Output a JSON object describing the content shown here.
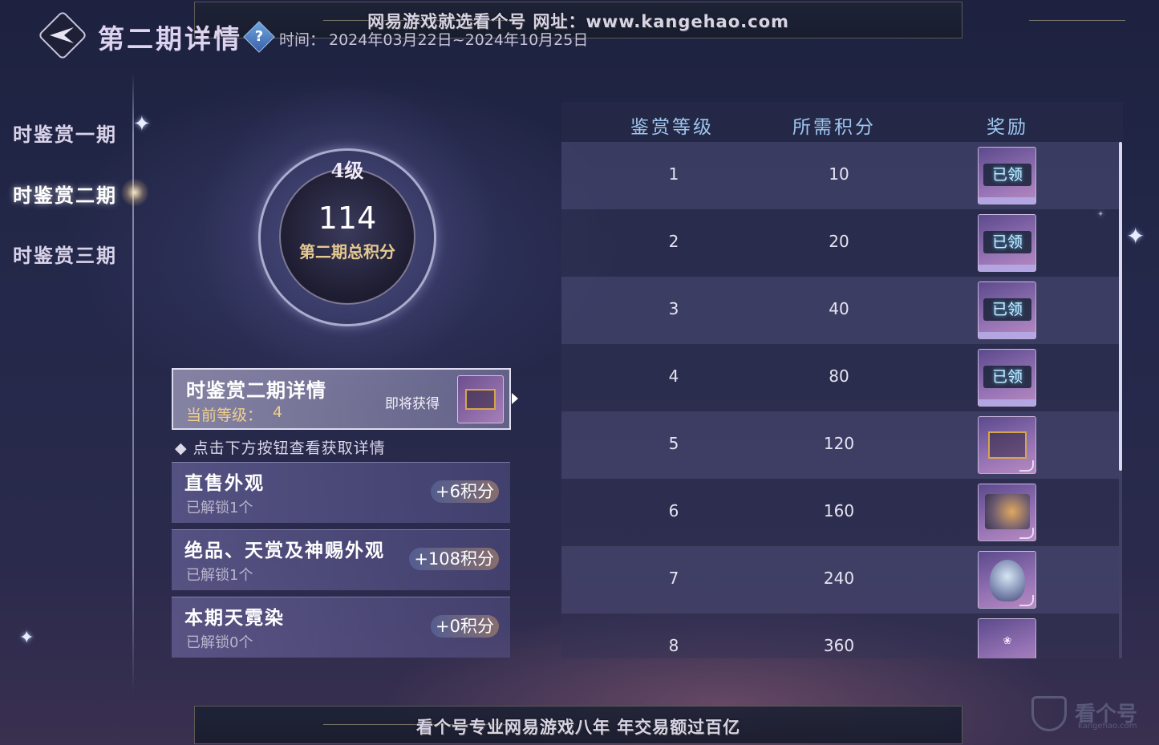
{
  "watermark_top": "网易游戏就选看个号  网址：www.kangehao.com",
  "watermark_bottom": "看个号专业网易游戏八年  年交易额过百亿",
  "header": {
    "title": "第二期详情",
    "help_symbol": "?",
    "time_label": "时间：",
    "time_value": "2024年03月22日~2024年10月25日"
  },
  "nav": {
    "items": [
      {
        "label": "时鉴赏一期",
        "active": false
      },
      {
        "label": "时鉴赏二期",
        "active": true
      },
      {
        "label": "时鉴赏三期",
        "active": false
      }
    ]
  },
  "medal": {
    "level": "4级",
    "score": "114",
    "caption": "第二期总积分"
  },
  "detail_card": {
    "title": "时鉴赏二期详情",
    "current_level_label": "当前等级：",
    "current_level_value": "4",
    "soon_label": "即将获得"
  },
  "hint": "◆ 点击下方按钮查看获取详情",
  "sources": [
    {
      "title": "直售外观",
      "sub": "已解锁1个",
      "badge": "+6积分"
    },
    {
      "title": "绝品、天赏及神赐外观",
      "sub": "已解锁1个",
      "badge": "+108积分"
    },
    {
      "title": "本期天霓染",
      "sub": "已解锁0个",
      "badge": "+0积分"
    }
  ],
  "table": {
    "headers": [
      "鉴赏等级",
      "所需积分",
      "奖励"
    ],
    "claimed_label": "已领",
    "rows": [
      {
        "level": "1",
        "points": "10",
        "reward": "claimed"
      },
      {
        "level": "2",
        "points": "20",
        "reward": "claimed"
      },
      {
        "level": "3",
        "points": "40",
        "reward": "claimed"
      },
      {
        "level": "4",
        "points": "80",
        "reward": "claimed"
      },
      {
        "level": "5",
        "points": "120",
        "reward": "frame"
      },
      {
        "level": "6",
        "points": "160",
        "reward": "art"
      },
      {
        "level": "7",
        "points": "240",
        "reward": "couple"
      },
      {
        "level": "8",
        "points": "360",
        "reward": "bow"
      }
    ]
  },
  "logo_watermark": {
    "text": "看个号",
    "url": "kangehao.com"
  },
  "colors": {
    "table_header": "#9ec6ef",
    "gold_text": "#f0cf8c",
    "claimed_text": "#c9f0ff"
  }
}
